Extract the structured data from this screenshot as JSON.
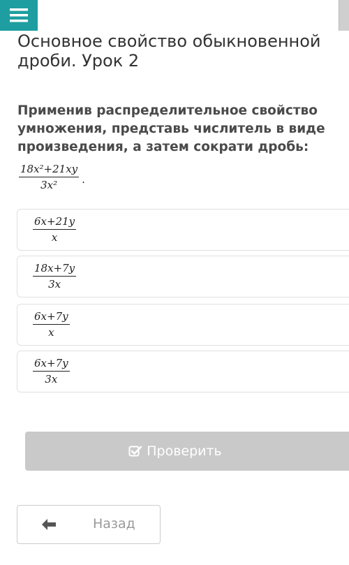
{
  "header": {
    "menu_icon": "hamburger-menu-icon",
    "accent_color": "#1e9ea0"
  },
  "lesson": {
    "title": "Основное свойство обыкновенной\nдроби. Урок 2"
  },
  "question": {
    "text": "Применив распределительное свойство\nумножения, представь числитель в виде\nпроизведения, а затем сократи дробь:",
    "expression": {
      "numerator": "18x²+21xy",
      "denominator": "3x²",
      "trailing": "."
    }
  },
  "options": [
    {
      "numerator": "6x+21y",
      "denominator": "x"
    },
    {
      "numerator": "18x+7y",
      "denominator": "3x"
    },
    {
      "numerator": "6x+7y",
      "denominator": "x"
    },
    {
      "numerator": "6x+7y",
      "denominator": "3x"
    }
  ],
  "actions": {
    "check_label": "Проверить",
    "check_icon": "checkbox-check-icon",
    "back_label": "Назад",
    "back_icon": "arrow-left-icon",
    "disabled_color": "#c9c9c9"
  }
}
